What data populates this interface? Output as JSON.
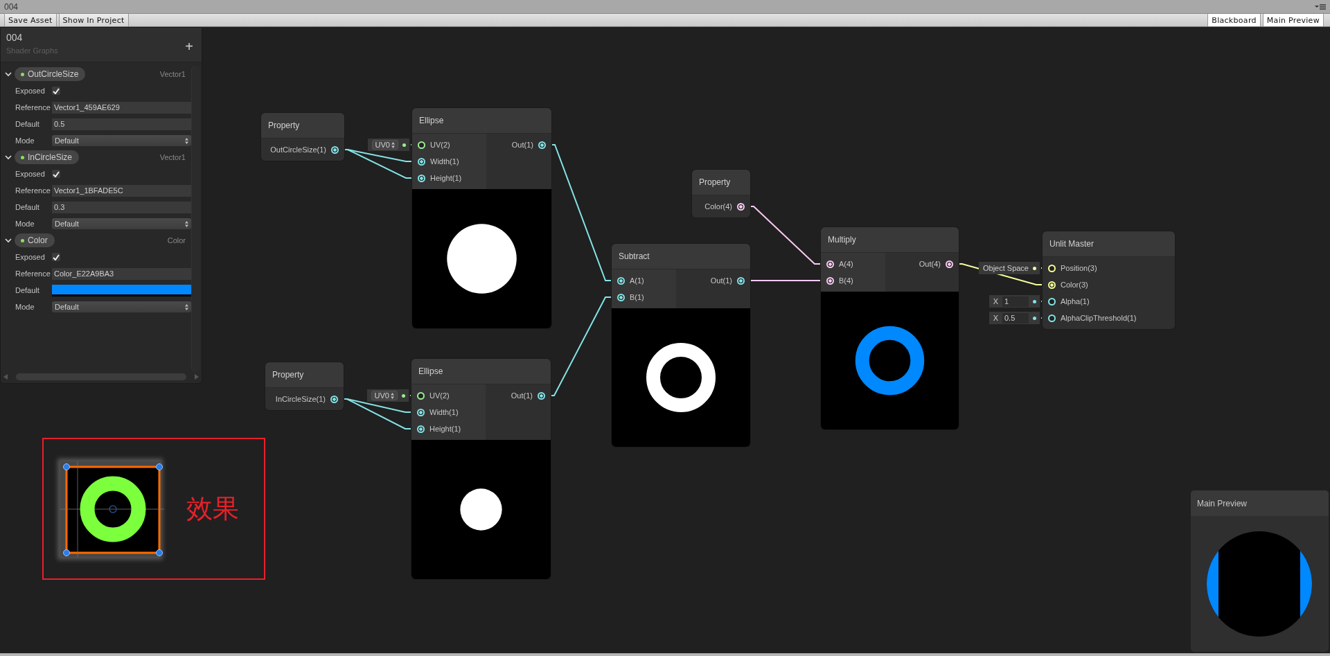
{
  "window": {
    "title": "004"
  },
  "toolbar": {
    "buttons": [
      "Save Asset",
      "Show In Project"
    ],
    "toggles": [
      {
        "label": "Blackboard",
        "on": true
      },
      {
        "label": "Main Preview",
        "on": true
      }
    ]
  },
  "blackboard": {
    "title": "004",
    "subtitle": "Shader Graphs",
    "add_button": "+",
    "properties": [
      {
        "name": "OutCircleSize",
        "type": "Vector1",
        "expanded": true,
        "fields": [
          {
            "kind": "checkbox",
            "label": "Exposed",
            "checked": true
          },
          {
            "kind": "text",
            "label": "Reference",
            "value": "Vector1_459AE629"
          },
          {
            "kind": "text",
            "label": "Default",
            "value": "0.5"
          },
          {
            "kind": "dropdown",
            "label": "Mode",
            "value": "Default"
          }
        ]
      },
      {
        "name": "InCircleSize",
        "type": "Vector1",
        "expanded": true,
        "fields": [
          {
            "kind": "checkbox",
            "label": "Exposed",
            "checked": true
          },
          {
            "kind": "text",
            "label": "Reference",
            "value": "Vector1_1BFADE5C"
          },
          {
            "kind": "text",
            "label": "Default",
            "value": "0.3"
          },
          {
            "kind": "dropdown",
            "label": "Mode",
            "value": "Default"
          }
        ]
      },
      {
        "name": "Color",
        "type": "Color",
        "expanded": true,
        "fields": [
          {
            "kind": "checkbox",
            "label": "Exposed",
            "checked": true
          },
          {
            "kind": "text",
            "label": "Reference",
            "value": "Color_E22A9BA3"
          },
          {
            "kind": "color",
            "label": "Default",
            "color": "#0088ff"
          },
          {
            "kind": "dropdown",
            "label": "Mode",
            "value": "Default"
          }
        ]
      }
    ]
  },
  "nodes": [
    {
      "kind": "property",
      "title": "Property",
      "outputs": [
        {
          "label": "OutCircleSize(1)",
          "color": "#84e4e7",
          "connected": true
        }
      ]
    },
    {
      "kind": "operation",
      "title": "Ellipse",
      "preview": {
        "kind": "disc"
      },
      "inputs": [
        {
          "label": "UV(2)",
          "color": "#9aef92",
          "connected": false,
          "default": {
            "kind": "dropdown",
            "value": "UV0"
          }
        },
        {
          "label": "Width(1)",
          "color": "#84e4e7",
          "connected": true
        },
        {
          "label": "Height(1)",
          "color": "#84e4e7",
          "connected": true
        }
      ],
      "outputs": [
        {
          "label": "Out(1)",
          "color": "#84e4e7",
          "connected": true
        }
      ]
    },
    {
      "kind": "property",
      "title": "Property",
      "outputs": [
        {
          "label": "InCircleSize(1)",
          "color": "#84e4e7",
          "connected": true
        }
      ]
    },
    {
      "kind": "operation",
      "title": "Ellipse",
      "preview": {
        "kind": "disc"
      },
      "inputs": [
        {
          "label": "UV(2)",
          "color": "#9aef92",
          "connected": false,
          "default": {
            "kind": "dropdown",
            "value": "UV0"
          }
        },
        {
          "label": "Width(1)",
          "color": "#84e4e7",
          "connected": true
        },
        {
          "label": "Height(1)",
          "color": "#84e4e7",
          "connected": true
        }
      ],
      "outputs": [
        {
          "label": "Out(1)",
          "color": "#84e4e7",
          "connected": true
        }
      ]
    },
    {
      "kind": "property",
      "title": "Property",
      "outputs": [
        {
          "label": "Color(4)",
          "color": "#fbcbf4",
          "connected": true
        }
      ]
    },
    {
      "kind": "operation",
      "title": "Subtract",
      "preview": {
        "kind": "ring"
      },
      "inputs": [
        {
          "label": "A(1)",
          "color": "#84e4e7",
          "connected": true
        },
        {
          "label": "B(1)",
          "color": "#84e4e7",
          "connected": true
        }
      ],
      "outputs": [
        {
          "label": "Out(1)",
          "color": "#84e4e7",
          "connected": true
        }
      ]
    },
    {
      "kind": "operation",
      "title": "Multiply",
      "preview": {
        "kind": "tinted-ring"
      },
      "inputs": [
        {
          "label": "A(4)",
          "color": "#fbcbf4",
          "connected": true
        },
        {
          "label": "B(4)",
          "color": "#fbcbf4",
          "connected": true
        }
      ],
      "outputs": [
        {
          "label": "Out(4)",
          "color": "#fbcbf4",
          "connected": true
        }
      ]
    },
    {
      "kind": "master",
      "title": "Unlit Master",
      "inputs": [
        {
          "label": "Position(3)",
          "color": "#f6ff9a",
          "connected": false,
          "default": {
            "kind": "space",
            "value": "Object Space"
          }
        },
        {
          "label": "Color(3)",
          "color": "#f6ff9a",
          "connected": true
        },
        {
          "label": "Alpha(1)",
          "color": "#84e4e7",
          "connected": false,
          "default": {
            "kind": "number",
            "axis": "X",
            "value": "1"
          }
        },
        {
          "label": "AlphaClipThreshold(1)",
          "color": "#84e4e7",
          "connected": false,
          "default": {
            "kind": "number",
            "axis": "X",
            "value": "0.5"
          }
        }
      ]
    }
  ],
  "effect": {
    "caption": "效果"
  },
  "main_preview": {
    "title": "Main Preview"
  }
}
